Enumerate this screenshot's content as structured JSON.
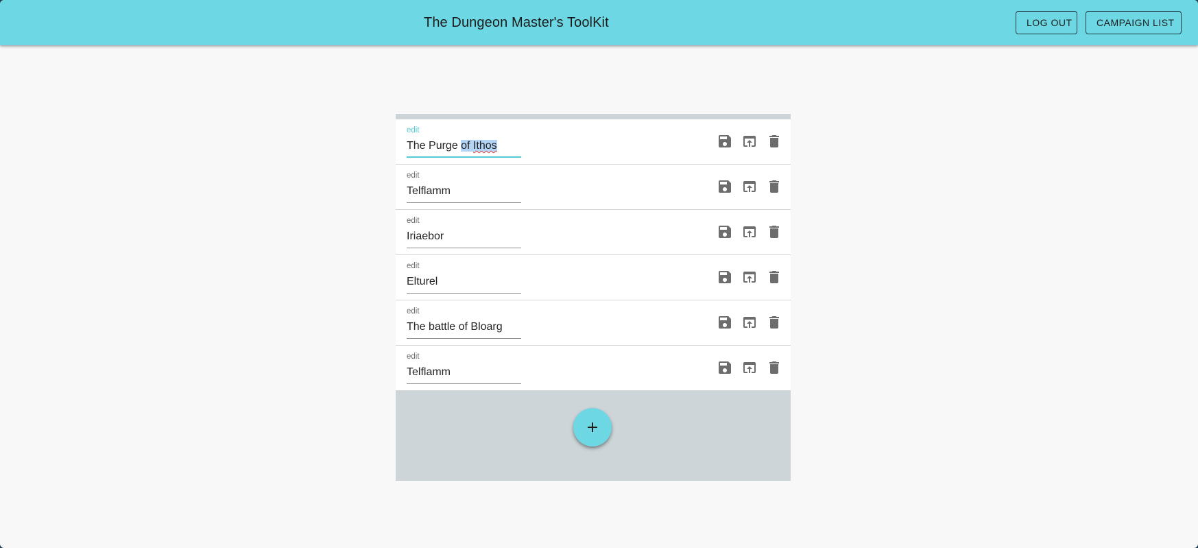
{
  "header": {
    "title": "The Dungeon Master's ToolKit",
    "logout_label": "LOG OUT",
    "campaign_list_label": "CAMPAIGN LIST"
  },
  "campaigns": [
    {
      "label": "edit",
      "value_plain": "The Purge ",
      "value_selected": "of ",
      "value_selected_spell": "Ithos",
      "focused": true
    },
    {
      "label": "edit",
      "value": "Telflamm"
    },
    {
      "label": "edit",
      "value": "Iriaebor"
    },
    {
      "label": "edit",
      "value": "Elturel"
    },
    {
      "label": "edit",
      "value": "The battle of Bloarg"
    },
    {
      "label": "edit",
      "value": "Telflamm"
    }
  ],
  "icons": {
    "save": "save-icon",
    "open": "open-in-browser-icon",
    "delete": "delete-icon",
    "add": "add-icon"
  },
  "colors": {
    "accent": "#6dd8e4",
    "focus": "#56c9d8",
    "icon": "#6d6d6d"
  }
}
